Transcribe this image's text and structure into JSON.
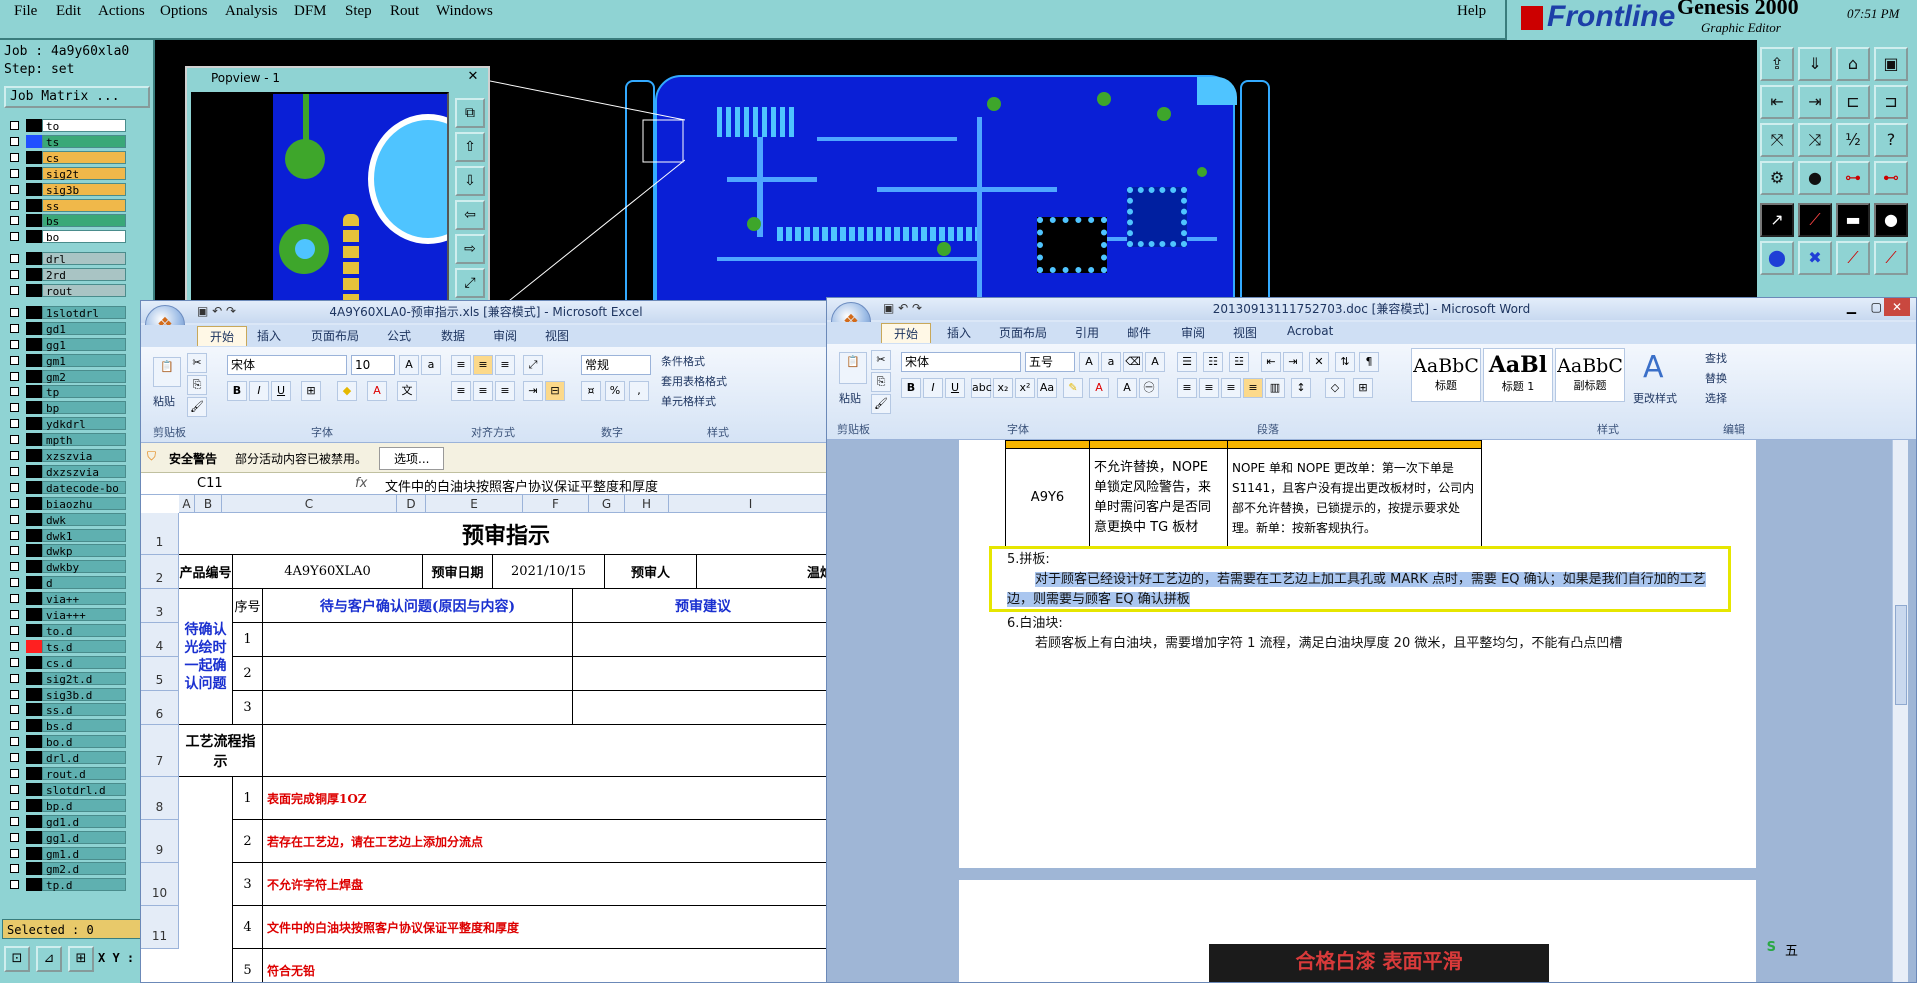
{
  "genesis": {
    "menu": [
      "File",
      "Edit",
      "Actions",
      "Options",
      "Analysis",
      "DFM",
      "Step",
      "Rout",
      "Windows"
    ],
    "help": "Help",
    "brand": "Frontline",
    "product": "Genesis 2000",
    "subtitle": "Graphic Editor",
    "time": "07:51 PM",
    "job": "Job : 4a9y60xla0",
    "step": "Step: set",
    "job_matrix": "Job Matrix ...",
    "layers": [
      {
        "name": "to",
        "color": "#ffffff"
      },
      {
        "name": "ts",
        "color": "#3aa878"
      },
      {
        "name": "cs",
        "color": "#f0b84a"
      },
      {
        "name": "sig2t",
        "color": "#f0b84a"
      },
      {
        "name": "sig3b",
        "color": "#f0b84a"
      },
      {
        "name": "ss",
        "color": "#f0b84a"
      },
      {
        "name": "bs",
        "color": "#3aa878"
      },
      {
        "name": "bo",
        "color": "#ffffff"
      },
      {
        "name": "drl",
        "color": "#a9c4c4"
      },
      {
        "name": "2rd",
        "color": "#a9c4c4"
      },
      {
        "name": "rout",
        "color": "#a9c4c4"
      },
      {
        "name": "1slotdrl",
        "color": "#5fb0b0"
      },
      {
        "name": "gd1",
        "color": "#5fb0b0"
      },
      {
        "name": "gg1",
        "color": "#5fb0b0"
      },
      {
        "name": "gm1",
        "color": "#5fb0b0"
      },
      {
        "name": "gm2",
        "color": "#5fb0b0"
      },
      {
        "name": "tp",
        "color": "#5fb0b0"
      },
      {
        "name": "bp",
        "color": "#5fb0b0"
      },
      {
        "name": "ydkdrl",
        "color": "#5fb0b0"
      },
      {
        "name": "mpth",
        "color": "#5fb0b0"
      },
      {
        "name": "xzszvia",
        "color": "#5fb0b0"
      },
      {
        "name": "dxzszvia",
        "color": "#5fb0b0"
      },
      {
        "name": "datecode-bo",
        "color": "#5fb0b0"
      },
      {
        "name": "biaozhu",
        "color": "#5fb0b0"
      },
      {
        "name": "dwk",
        "color": "#5fb0b0"
      },
      {
        "name": "dwk1",
        "color": "#5fb0b0"
      },
      {
        "name": "dwkp",
        "color": "#5fb0b0"
      },
      {
        "name": "dwkby",
        "color": "#5fb0b0"
      },
      {
        "name": "d",
        "color": "#5fb0b0"
      },
      {
        "name": "via++",
        "color": "#5fb0b0"
      },
      {
        "name": "via+++",
        "color": "#5fb0b0"
      },
      {
        "name": "to.d",
        "color": "#5fb0b0"
      },
      {
        "name": "ts.d",
        "color": "#5fb0b0"
      },
      {
        "name": "cs.d",
        "color": "#5fb0b0"
      },
      {
        "name": "sig2t.d",
        "color": "#5fb0b0"
      },
      {
        "name": "sig3b.d",
        "color": "#5fb0b0"
      },
      {
        "name": "ss.d",
        "color": "#5fb0b0"
      },
      {
        "name": "bs.d",
        "color": "#5fb0b0"
      },
      {
        "name": "bo.d",
        "color": "#5fb0b0"
      },
      {
        "name": "drl.d",
        "color": "#5fb0b0"
      },
      {
        "name": "rout.d",
        "color": "#5fb0b0"
      },
      {
        "name": "slotdrl.d",
        "color": "#5fb0b0"
      },
      {
        "name": "bp.d",
        "color": "#5fb0b0"
      },
      {
        "name": "gd1.d",
        "color": "#5fb0b0"
      },
      {
        "name": "gg1.d",
        "color": "#5fb0b0"
      },
      {
        "name": "gm1.d",
        "color": "#5fb0b0"
      },
      {
        "name": "gm2.d",
        "color": "#5fb0b0"
      },
      {
        "name": "tp.d",
        "color": "#5fb0b0"
      }
    ],
    "selected": "Selected : 0",
    "xy": "X Y :",
    "popview_title": "Popview - 1"
  },
  "excel": {
    "title": "4A9Y60XLA0-预审指示.xls [兼容模式] - Microsoft Excel",
    "tabs": [
      "开始",
      "插入",
      "页面布局",
      "公式",
      "数据",
      "审阅",
      "视图"
    ],
    "font_name": "宋体",
    "font_size": "10",
    "number_format": "常规",
    "groups": [
      "剪贴板",
      "字体",
      "对齐方式",
      "数字",
      "样式"
    ],
    "paste": "粘贴",
    "cond_format": "条件格式",
    "table_format": "套用表格格式",
    "cell_style": "单元格样式",
    "warning_title": "安全警告",
    "warning_text": "部分活动内容已被禁用。",
    "options_btn": "选项...",
    "cell_ref": "C11",
    "fx": "fx",
    "formula": "文件中的白油块按照客户协议保证平整度和厚度",
    "columns": [
      "A",
      "B",
      "C",
      "D",
      "E",
      "F",
      "G",
      "H",
      "I"
    ],
    "rows": [
      "1",
      "2",
      "3",
      "4",
      "5",
      "6",
      "7",
      "8",
      "9",
      "10",
      "11"
    ],
    "sheet_title": "预审指示",
    "product_no_label": "产品编号",
    "product_no": "4A9Y60XLA0",
    "review_date_label": "预审日期",
    "review_date": "2021/10/15",
    "reviewer_label": "预审人",
    "reviewer": "温灿",
    "pending_label": "待确认光绘时一起确认问题",
    "seq_label": "序号",
    "issue_label": "待与客户确认问题(原因与内容)",
    "suggest_label": "预审建议",
    "flow_label": "工艺流程指示",
    "items": [
      {
        "no": "1",
        "text": "表面完成铜厚1OZ"
      },
      {
        "no": "2",
        "text": "若存在工艺边，请在工艺边上添加分流点"
      },
      {
        "no": "3",
        "text": "不允许字符上焊盘"
      },
      {
        "no": "4",
        "text": "文件中的白油块按照客户协议保证平整度和厚度"
      },
      {
        "no": "5",
        "text": "符合无铅"
      }
    ],
    "pending_nos": [
      "1",
      "2",
      "3"
    ]
  },
  "word": {
    "title": "20130913111752703.doc [兼容模式] - Microsoft Word",
    "tabs": [
      "开始",
      "插入",
      "页面布局",
      "引用",
      "邮件",
      "审阅",
      "视图",
      "Acrobat"
    ],
    "font_name": "宋体",
    "font_size": "五号",
    "groups": [
      "剪贴板",
      "字体",
      "段落",
      "样式",
      "编辑"
    ],
    "paste": "粘贴",
    "styles": [
      {
        "preview": "AaBbC",
        "name": "标题"
      },
      {
        "preview": "AaBl",
        "name": "标题 1"
      },
      {
        "preview": "AaBbC",
        "name": "副标题"
      }
    ],
    "change_style": "更改样式",
    "find": "查找",
    "replace": "替换",
    "select": "选择",
    "table_code": "A9Y6",
    "table_col2": "不允许替换，NOPE 单锁定风险警告，来单时需问客户是否同意更换中 TG 板材",
    "table_col3": "NOPE 单和 NOPE 更改单：第一次下单是 S1141，且客户没有提出更改板材时，公司内部不允许替换，已锁提示的，按提示要求处理。新单：按新客规执行。",
    "item5_title": "5.拼板:",
    "item5_text": "对于顾客已经设计好工艺边的，若需要在工艺边上加工具孔或 MARK 点时，需要 EQ 确认；如果是我们自行加的工艺边，则需要与顾客 EQ 确认拼板",
    "item6_title": "6.白油块:",
    "item6_text": "若顾客板上有白油块，需要增加字符 1 流程，满足白油块厚度 20 微米，且平整均匀，不能有凸点凹槽",
    "image_text": "合格白漆 表面平滑",
    "ime": "五"
  }
}
